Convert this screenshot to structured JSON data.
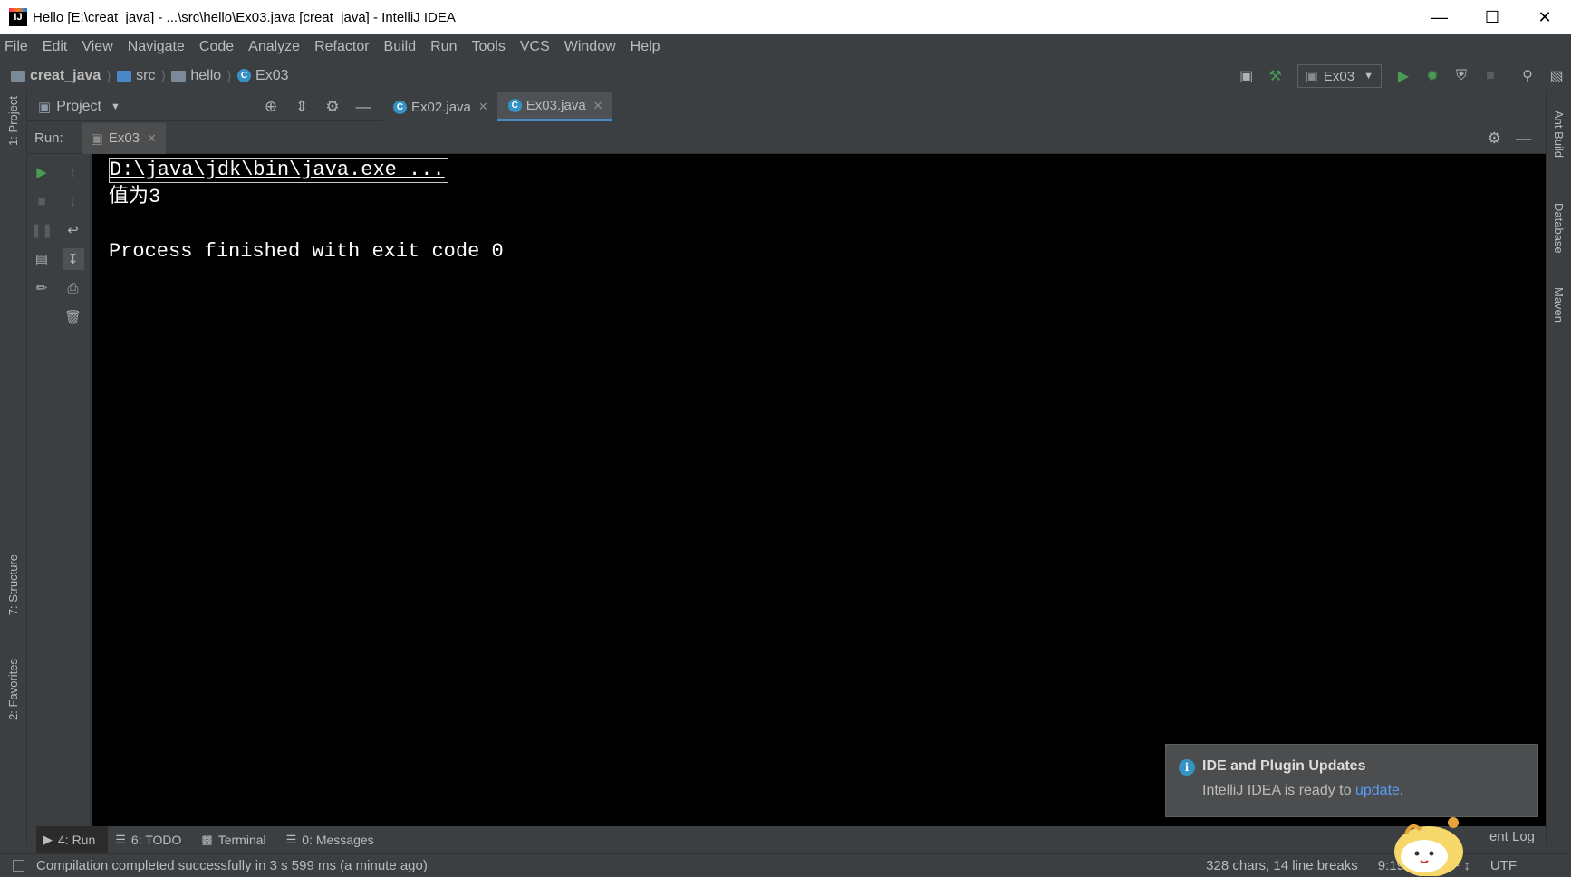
{
  "window": {
    "title": "Hello [E:\\creat_java] - ...\\src\\hello\\Ex03.java [creat_java] - IntelliJ IDEA",
    "app_icon_text": "IJ"
  },
  "menu": [
    "File",
    "Edit",
    "View",
    "Navigate",
    "Code",
    "Analyze",
    "Refactor",
    "Build",
    "Run",
    "Tools",
    "VCS",
    "Window",
    "Help"
  ],
  "breadcrumb": {
    "project": "creat_java",
    "folder1": "src",
    "folder2": "hello",
    "file": "Ex03"
  },
  "run_config": "Ex03",
  "project_panel": {
    "label": "Project"
  },
  "editor_tabs": [
    {
      "label": "Ex02.java",
      "active": false
    },
    {
      "label": "Ex03.java",
      "active": true
    }
  ],
  "left_strip": {
    "project": "1: Project",
    "structure": "7: Structure",
    "favorites": "2: Favorites"
  },
  "right_strip": {
    "ant": "Ant Build",
    "database": "Database",
    "maven": "Maven"
  },
  "run_panel": {
    "label": "Run:",
    "tab": "Ex03",
    "console_lines": [
      "D:\\java\\jdk\\bin\\java.exe ...",
      "值为3",
      "",
      "Process finished with exit code 0"
    ]
  },
  "bottom_tabs": [
    {
      "label": "4: Run",
      "active": true
    },
    {
      "label": "6: TODO",
      "active": false
    },
    {
      "label": "Terminal",
      "active": false
    },
    {
      "label": "0: Messages",
      "active": false
    }
  ],
  "status": {
    "message": "Compilation completed successfully in 3 s 599 ms (a minute ago)",
    "chars": "328 chars, 14 line breaks",
    "position": "9:19",
    "line_sep": "CRLF ↕",
    "encoding": "UTF",
    "event_log": "ent Log"
  },
  "notification": {
    "title": "IDE and Plugin Updates",
    "body": "IntelliJ IDEA is ready to ",
    "link": "update",
    "suffix": "."
  },
  "colors": {
    "bg": "#3c3f41",
    "console_bg": "#000000",
    "accent": "#4a88c7",
    "run_green": "#499c54"
  }
}
